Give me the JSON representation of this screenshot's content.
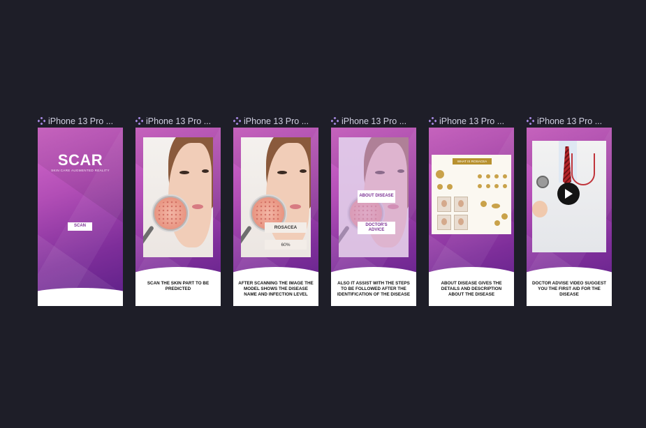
{
  "frames": [
    {
      "label": "iPhone 13 Pro ...",
      "logo": "SCAR",
      "tagline": "SKIN CARE AUGMENTED REALITY",
      "button": "SCAN",
      "caption": ""
    },
    {
      "label": "iPhone 13 Pro ...",
      "caption": "SCAN THE SKIN PART TO BE PREDICTED"
    },
    {
      "label": "iPhone 13 Pro ...",
      "result_name": "ROSACEA",
      "result_level": "60%",
      "caption": "AFTER SCANNING THE IMAGE THE MODEL SHOWS THE DISEASE NAME AND INFECTION LEVEL"
    },
    {
      "label": "iPhone 13 Pro ...",
      "about_button": "ABOUT DISEASE",
      "advice_button": "DOCTOR'S ADVICE",
      "caption": "ALSO IT ASSIST WITH THE STEPS TO BE FOLLOWED AFTER THE IDENTIFICATION OF THE DISEASE"
    },
    {
      "label": "iPhone 13 Pro ...",
      "infographic_title": "WHAT IS ROSACEA",
      "caption": "ABOUT DISEASE GIVES THE DETAILS AND DESCRIPTION ABOUT THE DISEASE"
    },
    {
      "label": "iPhone 13 Pro ...",
      "caption": "DOCTOR ADVISE VIDEO SUGGEST YOU THE FIRST AID FOR THE DISEASE"
    }
  ],
  "colors": {
    "background": "#1e1e28",
    "frame_icon": "#a98be6",
    "accent": "#7a2f93"
  },
  "icons": {
    "frame": "component-icon",
    "play": "play-icon",
    "magnifier": "magnifier-icon"
  }
}
